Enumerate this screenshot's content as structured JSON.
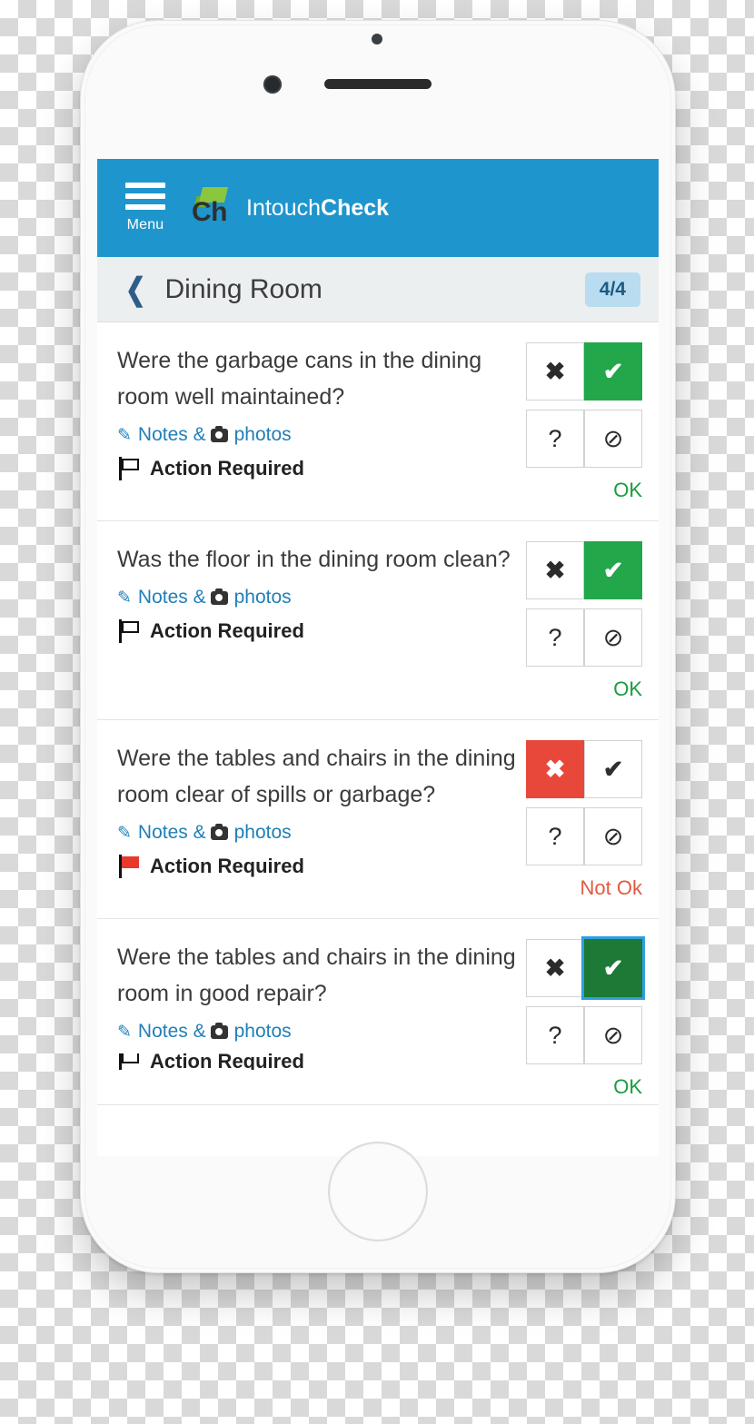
{
  "app": {
    "menu_label": "Menu",
    "brand_mark": "Ch",
    "brand_name_light": "Intouch",
    "brand_name_bold": "Check",
    "header_color": "#1f95cd"
  },
  "sub_header": {
    "back_icon": "chevron-left-icon",
    "title": "Dining Room",
    "count": "4/4"
  },
  "labels": {
    "notes_prefix": "Notes &",
    "notes_suffix": "photos",
    "action_required": "Action Required",
    "option_x": "✖",
    "option_check": "✔",
    "option_question": "?",
    "option_na": "⊘"
  },
  "items": [
    {
      "question": "Were the garbage cans in the dining room well maintained?",
      "notes_prefix": "Notes &",
      "notes_suffix": "photos",
      "action_required": "Action Required",
      "status": "OK",
      "status_kind": "ok",
      "selected": "check",
      "flag_red": false
    },
    {
      "question": "Was the floor in the dining room clean?",
      "notes_prefix": "Notes &",
      "notes_suffix": "photos",
      "action_required": "Action Required",
      "status": "OK",
      "status_kind": "ok",
      "selected": "check",
      "flag_red": false
    },
    {
      "question": "Were the tables and chairs in the dining room clear of spills or garbage?",
      "notes_prefix": "Notes &",
      "notes_suffix": "photos",
      "action_required": "Action Required",
      "status": "Not Ok",
      "status_kind": "notok",
      "selected": "x",
      "flag_red": true
    },
    {
      "question": "Were the tables and chairs in the dining room in good repair?",
      "notes_prefix": "Notes &",
      "notes_suffix": "photos",
      "action_required": "Action Required",
      "status": "OK",
      "status_kind": "ok",
      "selected": "check-focused",
      "flag_red": false
    }
  ]
}
